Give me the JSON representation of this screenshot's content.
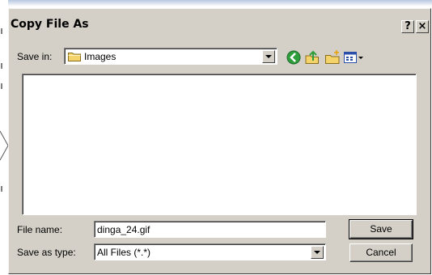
{
  "dialog": {
    "title": "Copy File As",
    "help_glyph": "?",
    "close_glyph": "×"
  },
  "save_in": {
    "label": "Save in:",
    "value": "Images",
    "icon": "folder-icon"
  },
  "toolbar": {
    "icons": [
      "back-icon",
      "up-folder-icon",
      "new-folder-icon",
      "view-menu-icon"
    ]
  },
  "file_name": {
    "label": "File name:",
    "value": "dinga_24.gif"
  },
  "save_as_type": {
    "label": "Save as type:",
    "value": "All Files (*.*)"
  },
  "buttons": {
    "save": "Save",
    "cancel": "Cancel"
  },
  "colors": {
    "dialog_bg": "#d4d0c8",
    "folder_yellow": "#f5d36b",
    "back_green": "#2e9e3c"
  }
}
